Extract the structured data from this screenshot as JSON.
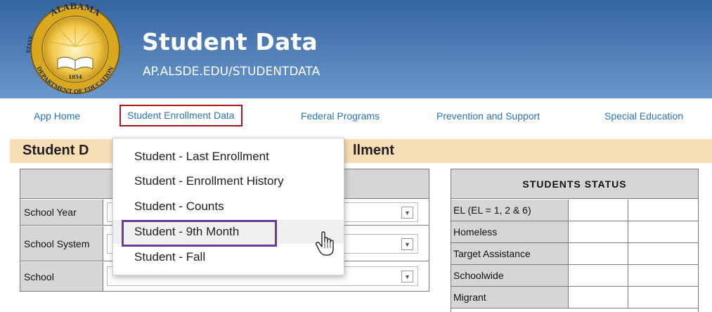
{
  "header": {
    "title": "Student Data",
    "url": "AP.ALSDE.EDU/STUDENTDATA",
    "seal_text": {
      "top": "ALABAMA",
      "left": "STATE",
      "bottom": "DEPARTMENT OF EDUCATION",
      "year": "1854"
    }
  },
  "nav": {
    "items": [
      {
        "label": "App Home"
      },
      {
        "label": "Student Enrollment Data",
        "active": true
      },
      {
        "label": "Federal Programs"
      },
      {
        "label": "Prevention and Support"
      },
      {
        "label": "Special Education"
      }
    ]
  },
  "page": {
    "title_left": "Student D",
    "title_right": "llment"
  },
  "form": {
    "rows": [
      {
        "label": "School Year",
        "value": ""
      },
      {
        "label": "School System",
        "value": ""
      },
      {
        "label": "School",
        "value": ""
      }
    ]
  },
  "status": {
    "header": "STUDENTS STATUS",
    "rows": [
      {
        "label": "EL (EL = 1, 2 & 6)"
      },
      {
        "label": "Homeless"
      },
      {
        "label": "Target Assistance"
      },
      {
        "label": "Schoolwide"
      },
      {
        "label": "Migrant"
      }
    ]
  },
  "dropdown": {
    "items": [
      {
        "label": "Student - Last Enrollment"
      },
      {
        "label": "Student - Enrollment History"
      },
      {
        "label": "Student - Counts"
      },
      {
        "label": "Student - 9th Month",
        "hovered": true
      },
      {
        "label": "Student - Fall"
      }
    ]
  },
  "colors": {
    "header_blue": "#4a79b3",
    "nav_link": "#2a72b8",
    "active_outline": "#a6171f",
    "hover_outline": "#6b3a9e",
    "title_bar": "#f8deb6",
    "table_gray": "#d6d6d6"
  },
  "icons": {
    "seal": "alabama-state-seal-icon",
    "dropdown_arrow": "chevron-down-icon",
    "cursor": "hand-pointer-icon"
  }
}
